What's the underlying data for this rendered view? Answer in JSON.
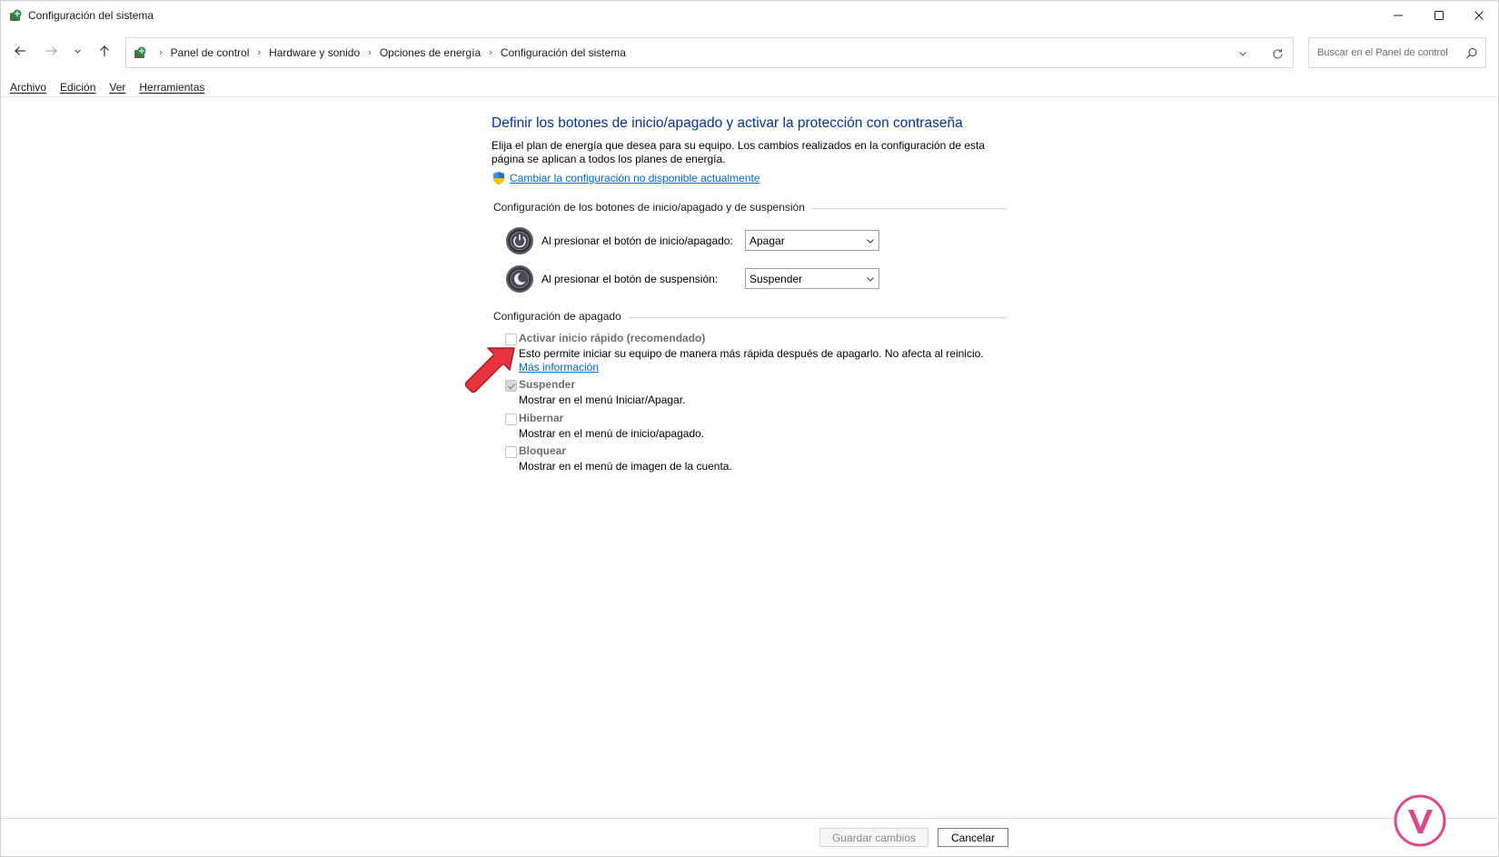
{
  "window": {
    "title": "Configuración del sistema",
    "controls": {
      "minimize_icon": "minimize-icon",
      "maximize_icon": "maximize-icon",
      "close_icon": "close-icon"
    }
  },
  "navigation": {
    "back_icon": "back-arrow-icon",
    "forward_icon": "forward-arrow-icon",
    "recent_icon": "chevron-down-icon",
    "up_icon": "up-arrow-icon"
  },
  "address": {
    "breadcrumbs": [
      "Panel de control",
      "Hardware y sonido",
      "Opciones de energía",
      "Configuración del sistema"
    ]
  },
  "search": {
    "placeholder": "Buscar en el Panel de control"
  },
  "menu": [
    "Archivo",
    "Edición",
    "Ver",
    "Herramientas"
  ],
  "main": {
    "title": "Definir los botones de inicio/apagado y activar la protección con contraseña",
    "description": "Elija el plan de energía que desea para su equipo. Los cambios realizados en la configuración de esta página se aplican a todos los planes de energía.",
    "change_link": "Cambiar la configuración no disponible actualmente",
    "buttons_section": {
      "heading": "Configuración de los botones de inicio/apagado y de suspensión",
      "power_button_label": "Al presionar el botón de inicio/apagado:",
      "power_button_value": "Apagar",
      "sleep_button_label": "Al presionar el botón de suspensión:",
      "sleep_button_value": "Suspender"
    },
    "shutdown_section": {
      "heading": "Configuración de apagado",
      "options": [
        {
          "label": "Activar inicio rápido (recomendado)",
          "description": "Esto permite iniciar su equipo de manera más rápida después de apagarlo. No afecta al reinicio.",
          "link": "Más información",
          "checked": false
        },
        {
          "label": "Suspender",
          "description": "Mostrar en el menú Iniciar/Apagar.",
          "checked": true
        },
        {
          "label": "Hibernar",
          "description": "Mostrar en el menú de inicio/apagado.",
          "checked": false
        },
        {
          "label": "Bloquear",
          "description": "Mostrar en el menú de imagen de la cuenta.",
          "checked": false
        }
      ]
    }
  },
  "footer": {
    "save_label": "Guardar cambios",
    "cancel_label": "Cancelar"
  },
  "colors": {
    "title_blue": "#003399",
    "link_blue": "#0066cc",
    "annotation_red": "#e8343f"
  }
}
